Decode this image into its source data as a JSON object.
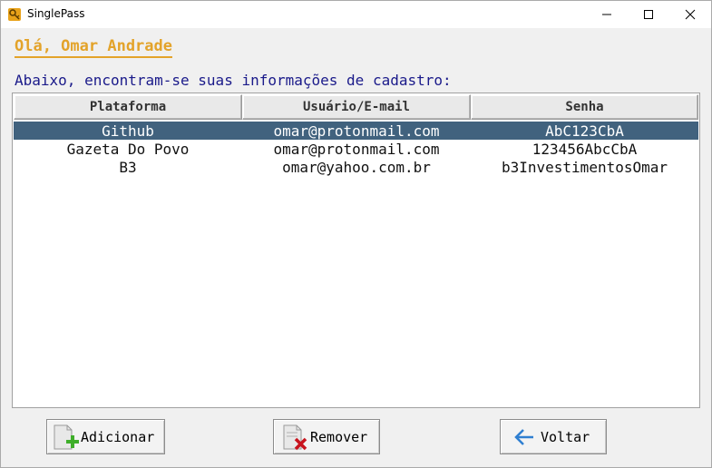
{
  "window": {
    "title": "SinglePass",
    "icon": "key-icon"
  },
  "greeting": "Olá, Omar Andrade",
  "subtitle": "Abaixo, encontram-se suas informações de cadastro:",
  "table": {
    "headers": [
      "Plataforma",
      "Usuário/E-mail",
      "Senha"
    ],
    "rows": [
      {
        "plataforma": "Github",
        "usuario": "omar@protonmail.com",
        "senha": "AbC123CbA",
        "selected": true
      },
      {
        "plataforma": "Gazeta Do Povo",
        "usuario": "omar@protonmail.com",
        "senha": "123456AbcCbA",
        "selected": false
      },
      {
        "plataforma": "B3",
        "usuario": "omar@yahoo.com.br",
        "senha": "b3InvestimentosOmar",
        "selected": false
      }
    ]
  },
  "buttons": {
    "add": {
      "label": "Adicionar",
      "icon": "add-document-icon"
    },
    "remove": {
      "label": "Remover",
      "icon": "remove-document-icon"
    },
    "back": {
      "label": "Voltar",
      "icon": "arrow-left-icon"
    }
  },
  "colors": {
    "accent": "#e3a32a",
    "subtitle": "#1a1a8a",
    "selection": "#41627e"
  }
}
